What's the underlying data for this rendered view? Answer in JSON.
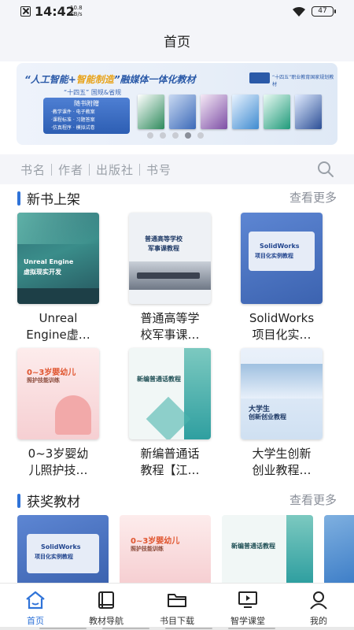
{
  "status_bar": {
    "time": "14:42",
    "speed_value": "10.8",
    "speed_unit": "KB/s",
    "battery": "47"
  },
  "header": {
    "title": "首页"
  },
  "banner": {
    "headline_part1": "“人工智能+",
    "headline_highlight": "智能制造",
    "headline_part2": "”融媒体一体化教材",
    "subtitle": "“十四五” 国规&省规",
    "box_title": "随书附赠",
    "box_rows": [
      "·教学课件 · 电子教案",
      "·课程标准 · 习题答案",
      "·仿真程序 · 模拟试卷"
    ],
    "badge_text": "“十四五”职业教育国家规划教材",
    "dots_total": 5,
    "dots_active": 4
  },
  "search": {
    "placeholder": "书名｜作者｜出版社｜书号",
    "icon": "search-icon"
  },
  "new_books": {
    "title": "新书上架",
    "more": "查看更多",
    "items": [
      {
        "name_l1": "Unreal",
        "name_l2": "Engine虚…",
        "cover_title": "Unreal Engine\n虚拟现实开发",
        "color": "#3c8a86"
      },
      {
        "name_l1": "普通高等学",
        "name_l2": "校军事课…",
        "cover_title": "普通高等学校\n军事课教程",
        "color": "#e9edf3"
      },
      {
        "name_l1": "SolidWorks",
        "name_l2": "项目化实…",
        "cover_title": "SolidWorks\n项目化实例教程",
        "color": "#4a78c8"
      },
      {
        "name_l1": "0~3岁婴幼",
        "name_l2": "儿照护技…",
        "cover_title": "0~3岁婴幼儿\n照护技能训练",
        "color": "#fbe3e3"
      },
      {
        "name_l1": "新编普通话",
        "name_l2": "教程【江…",
        "cover_title": "新编普通话教程",
        "color": "#eef6f5"
      },
      {
        "name_l1": "大学生创新",
        "name_l2": "创业教程…",
        "cover_title": "大学生\n创新创业教程",
        "color": "#e6eff8"
      }
    ]
  },
  "award_books": {
    "title": "获奖教材",
    "more": "查看更多",
    "items": [
      {
        "cover_title": "SolidWorks\n项目化实例教程",
        "color": "#4a78c8"
      },
      {
        "cover_title": "0~3岁婴幼儿\n照护技能训练",
        "color": "#fbe3e3"
      },
      {
        "cover_title": "新编普通话教程",
        "color": "#eef6f5"
      }
    ]
  },
  "tabbar": {
    "items": [
      {
        "label": "首页",
        "icon": "home-icon",
        "active": true
      },
      {
        "label": "教材导航",
        "icon": "book-icon",
        "active": false
      },
      {
        "label": "书目下载",
        "icon": "folder-icon",
        "active": false
      },
      {
        "label": "智学课堂",
        "icon": "classroom-icon",
        "active": false
      },
      {
        "label": "我的",
        "icon": "user-icon",
        "active": false
      }
    ]
  },
  "colors": {
    "accent": "#2f73d8",
    "background": "#f4f5f9"
  }
}
